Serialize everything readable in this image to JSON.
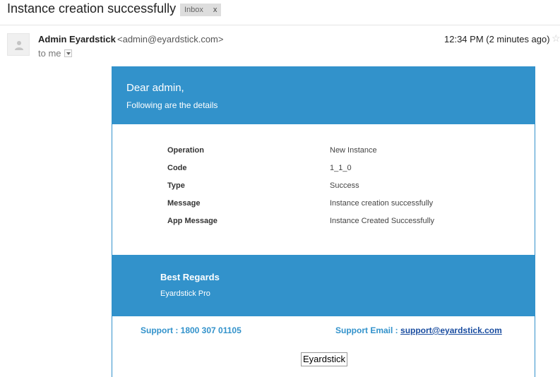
{
  "email": {
    "subject": "Instance creation successfully",
    "label_badge": "Inbox",
    "label_remove": "x",
    "sender_name": "Admin Eyardstick",
    "sender_email": "<admin@eyardstick.com>",
    "recipient": "to me",
    "timestamp": "12:34 PM (2 minutes ago)",
    "icons": {
      "avatar": "person-icon",
      "star": "star-icon",
      "dropdown": "chevron-down-icon"
    }
  },
  "body": {
    "greeting": "Dear admin,",
    "subgreeting": "Following are the details",
    "details": [
      {
        "label": "Operation",
        "value": "New Instance"
      },
      {
        "label": "Code",
        "value": "1_1_0"
      },
      {
        "label": "Type",
        "value": "Success"
      },
      {
        "label": "Message",
        "value": "Instance creation successfully"
      },
      {
        "label": "App Message",
        "value": "Instance Created Successfully"
      }
    ],
    "regards_title": "Best Regards",
    "regards_sig": "Eyardstick Pro",
    "support_phone": "Support : 1800 307 01105",
    "support_email_label": "Support Email :",
    "support_email": "support@eyardstick.com",
    "footer_logo": "Eyardstick"
  },
  "colors": {
    "accent": "#3292cb",
    "link": "#1a4da0"
  }
}
